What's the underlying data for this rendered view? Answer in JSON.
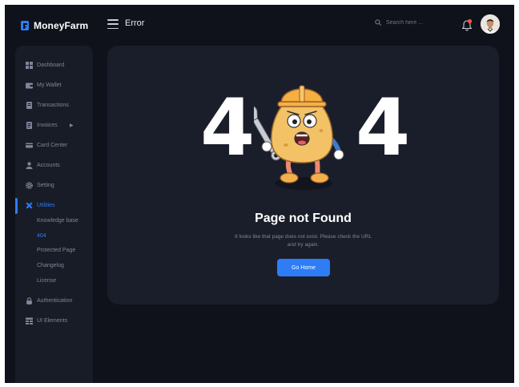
{
  "brand": {
    "name": "MoneyFarm"
  },
  "header": {
    "title": "Error",
    "search_placeholder": "Search here ..."
  },
  "sidebar": {
    "items": [
      {
        "label": "Dashboard",
        "icon": "dashboard-icon"
      },
      {
        "label": "My Wallet",
        "icon": "wallet-icon"
      },
      {
        "label": "Transactions",
        "icon": "transactions-icon"
      },
      {
        "label": "Invoices",
        "icon": "invoice-icon"
      },
      {
        "label": "Card Center",
        "icon": "card-icon"
      },
      {
        "label": "Accounts",
        "icon": "user-icon"
      },
      {
        "label": "Setting",
        "icon": "gear-icon"
      },
      {
        "label": "Utilities",
        "icon": "utilities-icon"
      },
      {
        "label": "Authentication",
        "icon": "lock-icon"
      },
      {
        "label": "UI Elements",
        "icon": "ui-elements-icon"
      }
    ],
    "utilities_sub": [
      {
        "label": "Knowledge base"
      },
      {
        "label": "404"
      },
      {
        "label": "Protected Page"
      },
      {
        "label": "Changelog"
      },
      {
        "label": "License"
      }
    ]
  },
  "error": {
    "code_left": "4",
    "code_right": "4",
    "title": "Page not Found",
    "message": "It looks like that page does not exist. Please check the URL and try again.",
    "button_label": "Go Home"
  },
  "colors": {
    "background": "#0f121b",
    "panel": "#1a1e2a",
    "accent": "#2e7cf6",
    "notification": "#f0563c"
  }
}
